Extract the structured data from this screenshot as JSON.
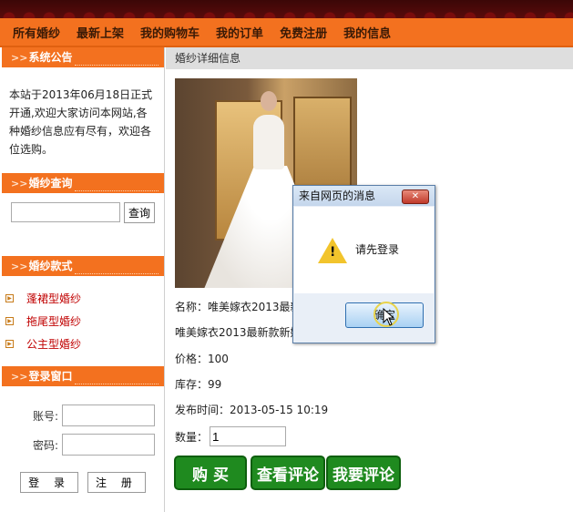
{
  "nav": [
    "所有婚纱",
    "最新上架",
    "我的购物车",
    "我的订单",
    "免费注册",
    "我的信息"
  ],
  "sidebar": {
    "notice_title": "系统公告",
    "notice_text": "本站于2013年06月18日正式开通,欢迎大家访问本网站,各种婚纱信息应有尽有，欢迎各位选购。",
    "search_title": "婚纱查询",
    "search_button": "查询",
    "styles_title": "婚纱款式",
    "styles": [
      "蓬裙型婚纱",
      "拖尾型婚纱",
      "公主型婚纱"
    ],
    "login_title": "登录窗口",
    "account_label": "账号:",
    "password_label": "密码:",
    "login_button": "登 录",
    "register_button": "注 册"
  },
  "main": {
    "breadcrumb": "婚纱详细信息",
    "name_line": "名称：唯美嫁衣2013最新",
    "desc_line": "唯美嫁衣2013最新款新娘",
    "price": "价格：100",
    "stock": "库存：99",
    "date": "发布时间：2013-05-15 10:19",
    "qty_label": "数量：",
    "qty_value": "1",
    "buy_button": "购 买",
    "view_comments_button": "查看评论",
    "add_comment_button": "我要评论"
  },
  "dialog": {
    "title": "来自网页的消息",
    "message": "请先登录",
    "ok_button": "确定"
  }
}
